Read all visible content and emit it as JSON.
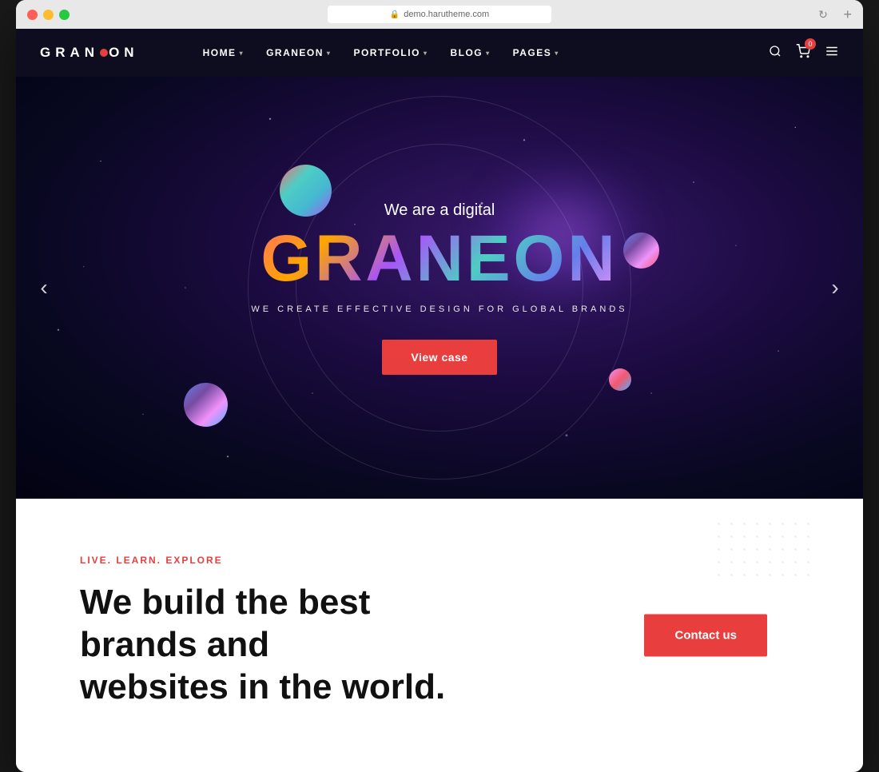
{
  "window": {
    "url": "demo.harutheme.com"
  },
  "navbar": {
    "logo": "GRANEON",
    "menu": [
      {
        "label": "HOME",
        "has_dropdown": true
      },
      {
        "label": "GRANEON",
        "has_dropdown": true
      },
      {
        "label": "PORTFOLIO",
        "has_dropdown": true
      },
      {
        "label": "BLOG",
        "has_dropdown": true
      },
      {
        "label": "PAGES",
        "has_dropdown": true
      }
    ],
    "cart_count": "0"
  },
  "hero": {
    "subtitle": "We are a digital",
    "title": "GRANEON",
    "tagline": "WE CREATE EFFECTIVE DESIGN FOR GLOBAL BRANDS",
    "cta_label": "View case"
  },
  "below_fold": {
    "tagline": "LIVE. LEARN. EXPLORE",
    "heading_line1": "We build the best brands and",
    "heading_line2": "websites in the world.",
    "contact_label": "Contact us"
  }
}
